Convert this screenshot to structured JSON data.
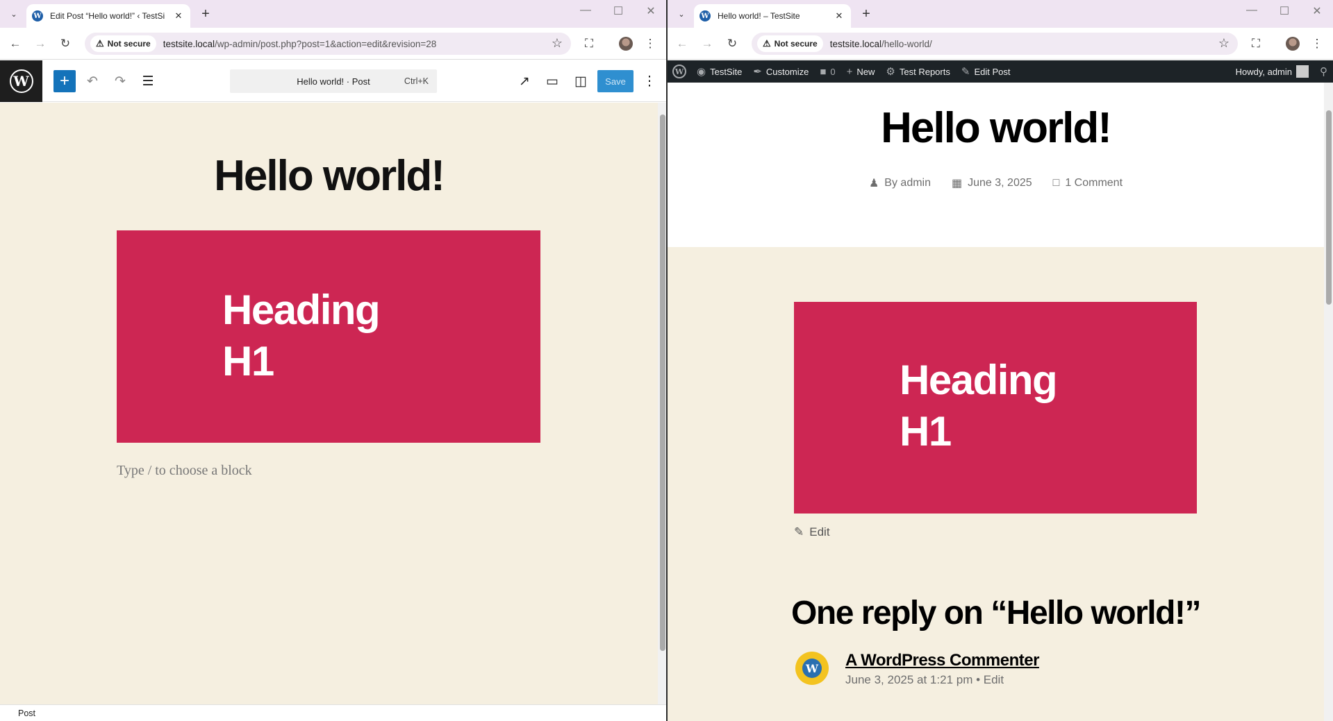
{
  "left_window": {
    "tab_title": "Edit Post “Hello world!” ‹ TestSi",
    "security_chip": "Not secure",
    "url_host": "testsite.local",
    "url_path": "/wp-admin/post.php?post=1&action=edit&revision=28",
    "editor": {
      "command_title": "Hello world! · Post",
      "command_shortcut": "Ctrl+K",
      "save_label": "Save",
      "post_title": "Hello world!",
      "cover_heading_line1": "Heading",
      "cover_heading_line2": "H1",
      "block_placeholder": "Type / to choose a block",
      "status_label": "Post"
    }
  },
  "right_window": {
    "tab_title": "Hello world! – TestSite",
    "security_chip": "Not secure",
    "url_host": "testsite.local",
    "url_path": "/hello-world/",
    "admin_bar": {
      "site_name": "TestSite",
      "customize": "Customize",
      "comments_count": "0",
      "new": "New",
      "test_reports": "Test Reports",
      "edit_post": "Edit Post",
      "howdy": "Howdy, admin"
    },
    "post": {
      "title": "Hello world!",
      "author": "By admin",
      "date": "June 3, 2025",
      "comments": "1 Comment",
      "cover_heading_line1": "Heading",
      "cover_heading_line2": "H1",
      "edit_label": "Edit",
      "replies_title": "One reply on “Hello world!”",
      "commenter_name": "A WordPress Commenter",
      "comment_meta": "June 3, 2025 at 1:21 pm • Edit"
    }
  },
  "colors": {
    "cover_bg": "#cd2653",
    "canvas_bg": "#f5efe0",
    "wp_blue": "#1473ba",
    "admin_bar_bg": "#1d2327"
  }
}
